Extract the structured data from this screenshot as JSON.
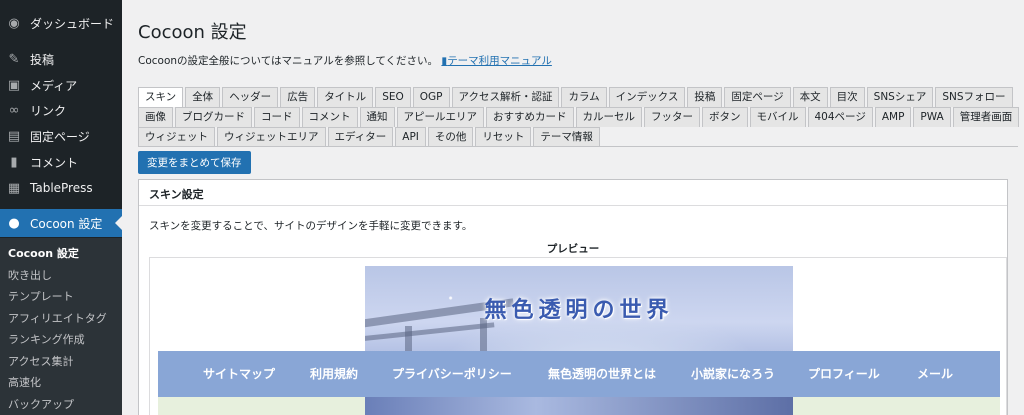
{
  "sidebar": {
    "items": [
      {
        "label": "ダッシュボード",
        "icon": "dashboard-icon"
      },
      {
        "label": "投稿",
        "icon": "pin-icon"
      },
      {
        "label": "メディア",
        "icon": "media-icon"
      },
      {
        "label": "リンク",
        "icon": "link-icon"
      },
      {
        "label": "固定ページ",
        "icon": "page-icon"
      },
      {
        "label": "コメント",
        "icon": "comment-icon"
      },
      {
        "label": "TablePress",
        "icon": "table-icon"
      },
      {
        "label": "Cocoon 設定",
        "icon": "cocoon-icon"
      }
    ],
    "submenu": [
      "Cocoon 設定",
      "吹き出し",
      "テンプレート",
      "アフィリエイトタグ",
      "ランキング作成",
      "アクセス集計",
      "高速化",
      "バックアップ"
    ]
  },
  "page": {
    "title": "Cocoon 設定",
    "intro_text": "Cocoonの設定全般についてはマニュアルを参照してください。",
    "manual_link": "テーマ利用マニュアル"
  },
  "tabs": {
    "row1": [
      "スキン",
      "全体",
      "ヘッダー",
      "広告",
      "タイトル",
      "SEO",
      "OGP",
      "アクセス解析・認証",
      "カラム",
      "インデックス",
      "投稿",
      "固定ページ",
      "本文",
      "目次",
      "SNSシェア",
      "SNSフォロー"
    ],
    "row2": [
      "画像",
      "ブログカード",
      "コード",
      "コメント",
      "通知",
      "アピールエリア",
      "おすすめカード",
      "カルーセル",
      "フッター",
      "ボタン",
      "モバイル",
      "404ページ",
      "AMP",
      "PWA",
      "管理者画面"
    ],
    "row3": [
      "ウィジェット",
      "ウィジェットエリア",
      "エディター",
      "API",
      "その他",
      "リセット",
      "テーマ情報"
    ],
    "active": "スキン"
  },
  "save_button": "変更をまとめて保存",
  "skin_panel": {
    "title": "スキン設定",
    "description": "スキンを変更することで、サイトのデザインを手軽に変更できます。",
    "preview_label": "プレビュー",
    "hero_title": "無色透明の世界",
    "nav_items": [
      "サイトマップ",
      "利用規約",
      "プライバシーポリシー",
      "無色透明の世界とは",
      "小説家になろう",
      "プロフィール",
      "メール"
    ]
  },
  "colors": {
    "sidebar_bg": "#1d2327",
    "accent": "#2271b1",
    "nav_bg": "#89a6d6"
  }
}
